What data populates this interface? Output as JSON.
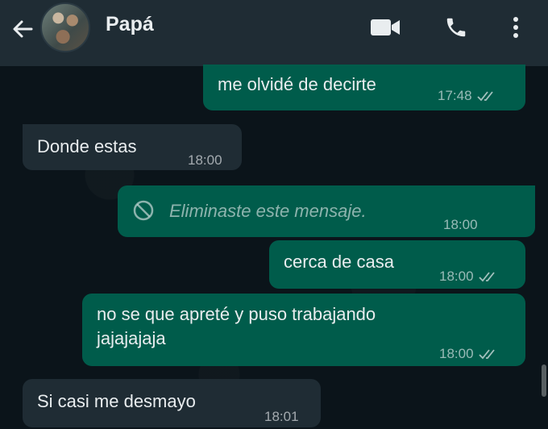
{
  "header": {
    "back_icon": "arrow-left-icon",
    "contact_name": "Papá",
    "video_icon": "video-camera-icon",
    "call_icon": "phone-icon",
    "menu_icon": "more-vert-icon"
  },
  "colors": {
    "header_bg": "#1f2c34",
    "chat_bg": "#0b141a",
    "outgoing_bubble": "#005c4b",
    "incoming_bubble": "#1f2c34"
  },
  "messages": [
    {
      "direction": "out",
      "text": "me olvidé de decirte",
      "time": "17:48",
      "status": "double-check-icon"
    },
    {
      "direction": "in",
      "text": "Donde estas",
      "time": "18:00"
    },
    {
      "direction": "out",
      "deleted": true,
      "icon": "blocked-icon",
      "text": "Eliminaste este mensaje.",
      "time": "18:00"
    },
    {
      "direction": "out",
      "text": "cerca de casa",
      "time": "18:00",
      "status": "double-check-icon"
    },
    {
      "direction": "out",
      "text_line1": "no se que apreté y puso trabajando",
      "text_line2": "jajajajaja",
      "time": "18:00",
      "status": "double-check-icon"
    },
    {
      "direction": "in",
      "text": "Si casi me desmayo",
      "time": "18:01"
    }
  ]
}
